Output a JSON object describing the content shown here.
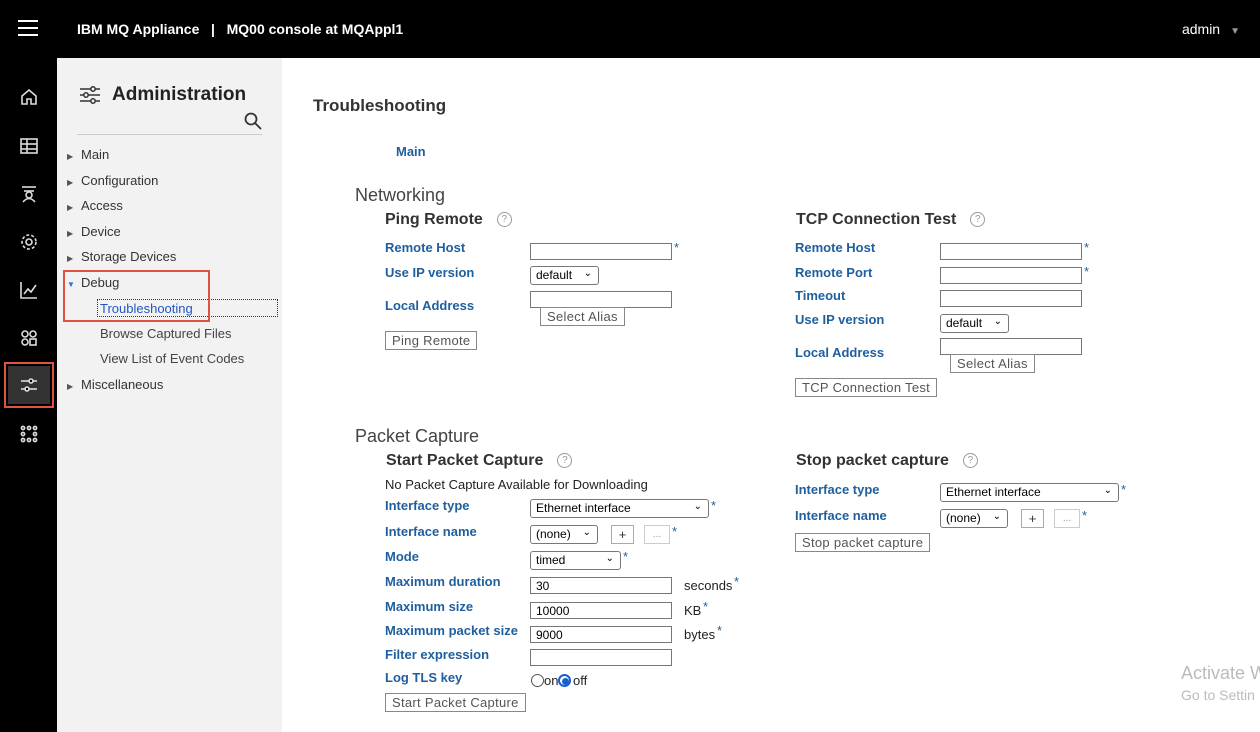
{
  "header": {
    "brand": "IBM MQ Appliance   |   MQ00 console at MQAppl1",
    "user": "admin"
  },
  "rail": {
    "icons": [
      "home-icon",
      "table-icon",
      "queue-manager-icon",
      "gear-icon",
      "chart-icon",
      "widgets-icon",
      "sliders-icon",
      "apps-icon"
    ],
    "active": "sliders-icon"
  },
  "sidebar": {
    "title": "Administration",
    "items": [
      {
        "label": "Main",
        "expanded": false
      },
      {
        "label": "Configuration",
        "expanded": false
      },
      {
        "label": "Access",
        "expanded": false
      },
      {
        "label": "Device",
        "expanded": false
      },
      {
        "label": "Storage Devices",
        "expanded": false
      },
      {
        "label": "Debug",
        "expanded": true
      },
      {
        "label": "Miscellaneous",
        "expanded": false
      }
    ],
    "debug_children": [
      "Troubleshooting",
      "Browse Captured Files",
      "View List of Event Codes"
    ]
  },
  "main": {
    "title": "Troubleshooting",
    "main_link": "Main",
    "networking": {
      "heading": "Networking",
      "ping": {
        "heading": "Ping Remote",
        "remote_host_label": "Remote Host",
        "remote_host_value": "",
        "ip_version_label": "Use IP version",
        "ip_version_value": "default",
        "local_address_label": "Local Address",
        "local_address_value": "",
        "select_alias": "Select Alias",
        "button": "Ping Remote"
      },
      "tcp": {
        "heading": "TCP Connection Test",
        "remote_host_label": "Remote Host",
        "remote_port_label": "Remote Port",
        "timeout_label": "Timeout",
        "ip_version_label": "Use IP version",
        "ip_version_value": "default",
        "local_address_label": "Local Address",
        "select_alias": "Select Alias",
        "button": "TCP Connection Test"
      }
    },
    "packet_capture": {
      "heading": "Packet Capture",
      "start": {
        "heading": "Start Packet Capture",
        "note": "No Packet Capture Available for Downloading",
        "interface_type_label": "Interface type",
        "interface_type_value": "Ethernet interface",
        "interface_name_label": "Interface name",
        "interface_name_value": "(none)",
        "mode_label": "Mode",
        "mode_value": "timed",
        "max_duration_label": "Maximum duration",
        "max_duration_value": "30",
        "max_duration_unit": "seconds",
        "max_size_label": "Maximum size",
        "max_size_value": "10000",
        "max_size_unit": "KB",
        "max_packet_label": "Maximum packet size",
        "max_packet_value": "9000",
        "max_packet_unit": "bytes",
        "filter_label": "Filter expression",
        "filter_value": "",
        "log_tls_label": "Log TLS key",
        "on_label": "on",
        "off_label": "off",
        "log_tls_selected": "off",
        "button": "Start Packet Capture"
      },
      "stop": {
        "heading": "Stop packet capture",
        "interface_type_label": "Interface type",
        "interface_type_value": "Ethernet interface",
        "interface_name_label": "Interface name",
        "interface_name_value": "(none)",
        "button": "Stop packet capture"
      }
    },
    "plus": "+",
    "dots": "...",
    "required_mark": "*",
    "help_mark": "?"
  },
  "watermark": {
    "line1": "Activate W",
    "line2": "Go to Settin"
  }
}
